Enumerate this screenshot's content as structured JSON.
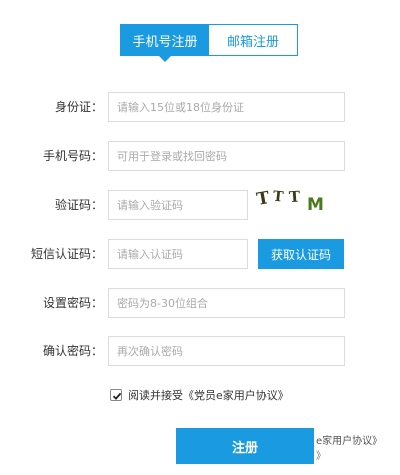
{
  "tabs": [
    {
      "label": "手机号注册",
      "active": true
    },
    {
      "label": "邮箱注册",
      "active": false
    }
  ],
  "form": {
    "id_card": {
      "label": "身份证：",
      "placeholder": "请输入15位或18位身份证"
    },
    "phone": {
      "label": "手机号码：",
      "placeholder": "可用于登录或找回密码"
    },
    "captcha": {
      "label": "验证码：",
      "placeholder": "请输入验证码",
      "image_text": "T T T M"
    },
    "sms_code": {
      "label": "短信认证码：",
      "placeholder": "请输入认证码",
      "button": "获取认证码"
    },
    "password": {
      "label": "设置密码：",
      "placeholder": "密码为8-30位组合"
    },
    "confirm_password": {
      "label": "确认密码：",
      "placeholder": "再次确认密码"
    }
  },
  "agreement": {
    "checked": true,
    "text": "阅读并接受《党员e家用户协议》"
  },
  "submit_label": "注册",
  "overlap_text": "e家用户协议》",
  "overlap_extra": "》",
  "colors": {
    "accent": "#1a9ae0",
    "captcha_dark": "#3a3a1a",
    "captcha_green": "#4a7a1a"
  }
}
